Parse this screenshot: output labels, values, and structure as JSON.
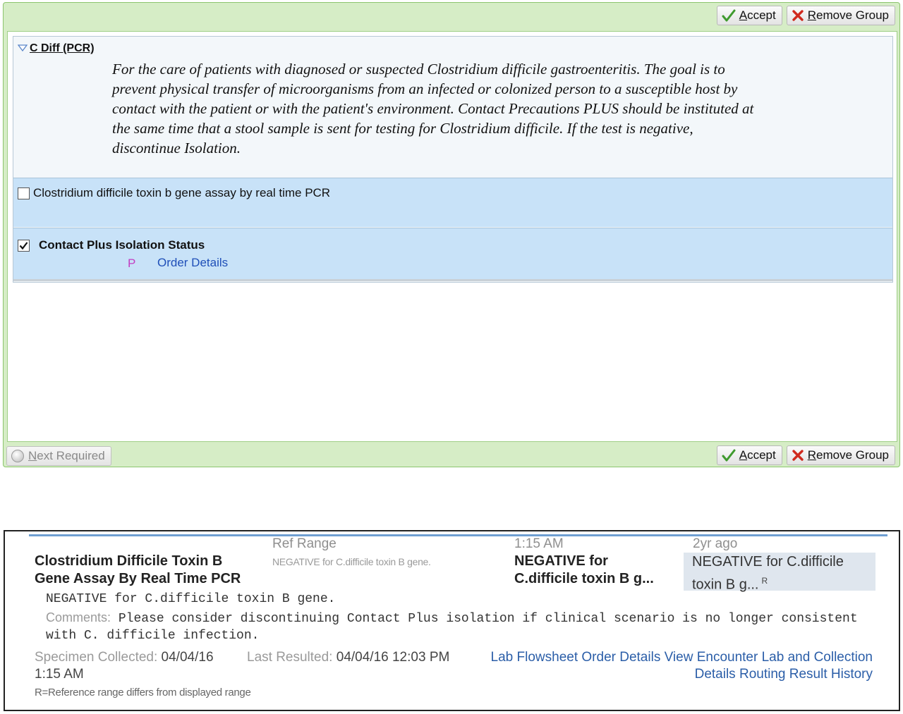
{
  "order_group": {
    "toolbar": {
      "accept_label": "Accept",
      "remove_group_label": "Remove Group"
    },
    "footer": {
      "next_required_label": "Next Required"
    },
    "group": {
      "title": "C Diff (PCR)",
      "description": "For the care of patients with diagnosed or suspected Clostridium difficile gastroenteritis. The goal is to prevent physical transfer of microorganisms from an infected or colonized person to a susceptible host by contact with the patient or with the patient's environment. Contact Precautions PLUS should be instituted at the same time that a stool sample is sent for testing for Clostridium difficile. If the test is negative, discontinue Isolation."
    },
    "orders": [
      {
        "label": "Clostridium difficile toxin b gene assay by real time PCR",
        "checked": false
      },
      {
        "label": "Contact Plus Isolation Status",
        "checked": true,
        "badge": "P",
        "link": "Order Details"
      }
    ]
  },
  "lab_result": {
    "test_name": "Clostridium Difficile Toxin B Gene Assay By Real Time PCR",
    "columns": {
      "ref_range": "Ref Range",
      "time": "1:15 AM",
      "ago": "2yr ago"
    },
    "ref_range_value": "NEGATIVE for C.difficile toxin B gene.",
    "result_value": "NEGATIVE for C.difficile toxin B g...",
    "previous_value": "NEGATIVE for C.difficile toxin B g...",
    "previous_flag": "R",
    "result_text": "NEGATIVE for C.difficile toxin B gene.",
    "comments_label": "Comments:",
    "comments_text": "Please consider discontinuing Contact Plus isolation if clinical scenario is no longer consistent with C. difficile infection.",
    "specimen_label": "Specimen Collected:",
    "specimen_value": "04/04/16 1:15 AM",
    "last_resulted_label": "Last Resulted:",
    "last_resulted_value": "04/04/16 12:03 PM",
    "links": [
      "Lab Flowsheet",
      "Order Details",
      "View Encounter",
      "Lab and Collection Details",
      "Routing",
      "Result History"
    ],
    "footnote": "R=Reference range differs from displayed range"
  }
}
